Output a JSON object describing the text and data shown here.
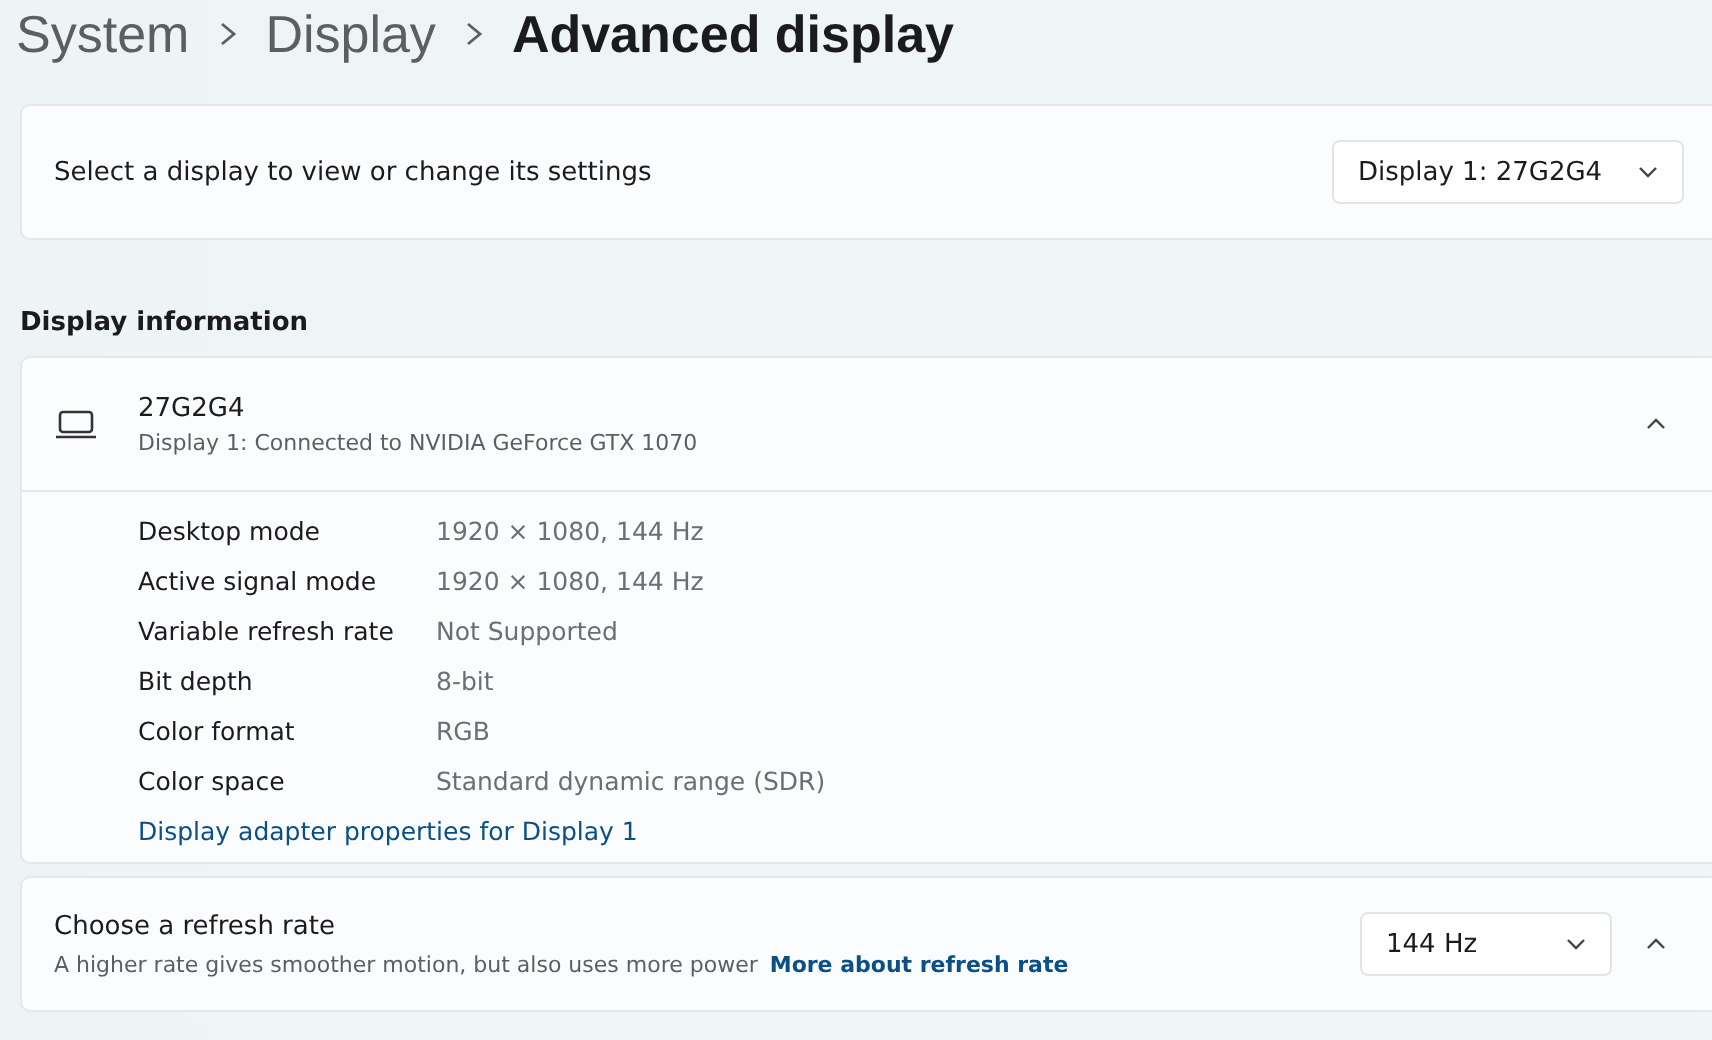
{
  "breadcrumb": [
    "System",
    "Display",
    "Advanced display"
  ],
  "display_select": {
    "label": "Select a display to view or change its settings",
    "value": "Display 1: 27G2G4"
  },
  "section_title": "Display information",
  "display_info": {
    "name": "27G2G4",
    "subtitle": "Display 1: Connected to NVIDIA GeForce GTX 1070",
    "expanded": true,
    "rows": [
      {
        "label": "Desktop mode",
        "value": "1920 × 1080, 144 Hz"
      },
      {
        "label": "Active signal mode",
        "value": "1920 × 1080, 144 Hz"
      },
      {
        "label": "Variable refresh rate",
        "value": "Not Supported"
      },
      {
        "label": "Bit depth",
        "value": "8-bit"
      },
      {
        "label": "Color format",
        "value": "RGB"
      },
      {
        "label": "Color space",
        "value": "Standard dynamic range (SDR)"
      }
    ],
    "link": "Display adapter properties for Display 1"
  },
  "refresh_rate": {
    "title": "Choose a refresh rate",
    "description": "A higher rate gives smoother motion, but also uses more power",
    "link": "More about refresh rate",
    "value": "144 Hz",
    "expanded": true
  }
}
